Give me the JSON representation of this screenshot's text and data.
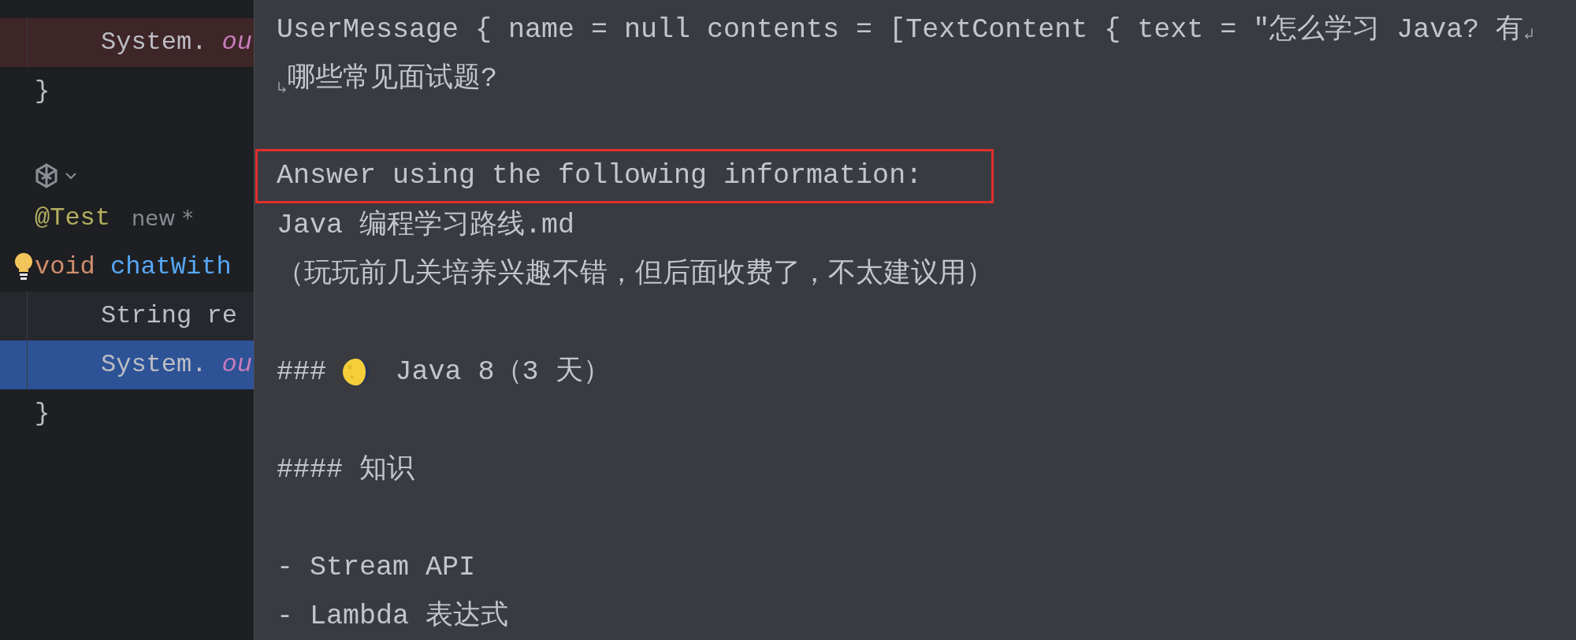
{
  "editor": {
    "lines": [
      {
        "kind": "deleted_code",
        "indented": true,
        "selected": false,
        "bulb": false,
        "tokens": [
          {
            "text": "System.",
            "kind": "plain"
          },
          {
            "text": "ou",
            "kind": "field"
          }
        ]
      },
      {
        "kind": "code",
        "indented": false,
        "selected": false,
        "bulb": false,
        "tokens": [
          {
            "text": "}",
            "kind": "plain"
          }
        ]
      },
      {
        "kind": "blank"
      },
      {
        "kind": "inlay"
      },
      {
        "kind": "code",
        "indented": false,
        "selected": false,
        "bulb": false,
        "tokens": [
          {
            "text": "@Test",
            "kind": "annotation"
          },
          {
            "text": "new *",
            "kind": "hint"
          }
        ]
      },
      {
        "kind": "code",
        "indented": false,
        "selected": false,
        "bulb": true,
        "tokens": [
          {
            "text": "void",
            "kind": "keyword"
          },
          {
            "text": "chatWith",
            "kind": "method"
          }
        ]
      },
      {
        "kind": "caret_code",
        "indented": true,
        "selected": false,
        "bulb": false,
        "tokens": [
          {
            "text": "String re",
            "kind": "plain"
          }
        ]
      },
      {
        "kind": "code",
        "indented": true,
        "selected": true,
        "bulb": false,
        "tokens": [
          {
            "text": "System.",
            "kind": "plain"
          },
          {
            "text": "ou",
            "kind": "field"
          }
        ]
      },
      {
        "kind": "code",
        "indented": false,
        "selected": false,
        "bulb": false,
        "tokens": [
          {
            "text": "}",
            "kind": "plain"
          }
        ]
      }
    ]
  },
  "popup": {
    "lines": [
      {
        "kind": "text",
        "text": "UserMessage { name = null contents = [TextContent { text = \"怎么学习 Java? 有",
        "boxed": false,
        "wrap_start": false,
        "wrap_end": true
      },
      {
        "kind": "text",
        "text": "哪些常见面试题?",
        "boxed": false,
        "wrap_start": true,
        "wrap_end": false
      },
      {
        "kind": "blank"
      },
      {
        "kind": "text",
        "text": "Answer using the following information:",
        "boxed": true,
        "wrap_start": false,
        "wrap_end": false
      },
      {
        "kind": "text",
        "text": "Java 编程学习路线.md",
        "boxed": false,
        "wrap_start": false,
        "wrap_end": false
      },
      {
        "kind": "text",
        "text": "（玩玩前几关培养兴趣不错，但后面收费了，不太建议用）",
        "boxed": false,
        "wrap_start": false,
        "wrap_end": false
      },
      {
        "kind": "blank"
      },
      {
        "kind": "icon_heading",
        "text": "###",
        "text_after": "Java 8（3 天）"
      },
      {
        "kind": "blank"
      },
      {
        "kind": "text",
        "text": "#### 知识",
        "boxed": false,
        "wrap_start": false,
        "wrap_end": false
      },
      {
        "kind": "blank"
      },
      {
        "kind": "text",
        "text": "- Stream API",
        "boxed": false,
        "wrap_start": false,
        "wrap_end": false
      },
      {
        "kind": "text",
        "text": "- Lambda 表达式",
        "boxed": false,
        "wrap_start": false,
        "wrap_end": false
      }
    ]
  }
}
